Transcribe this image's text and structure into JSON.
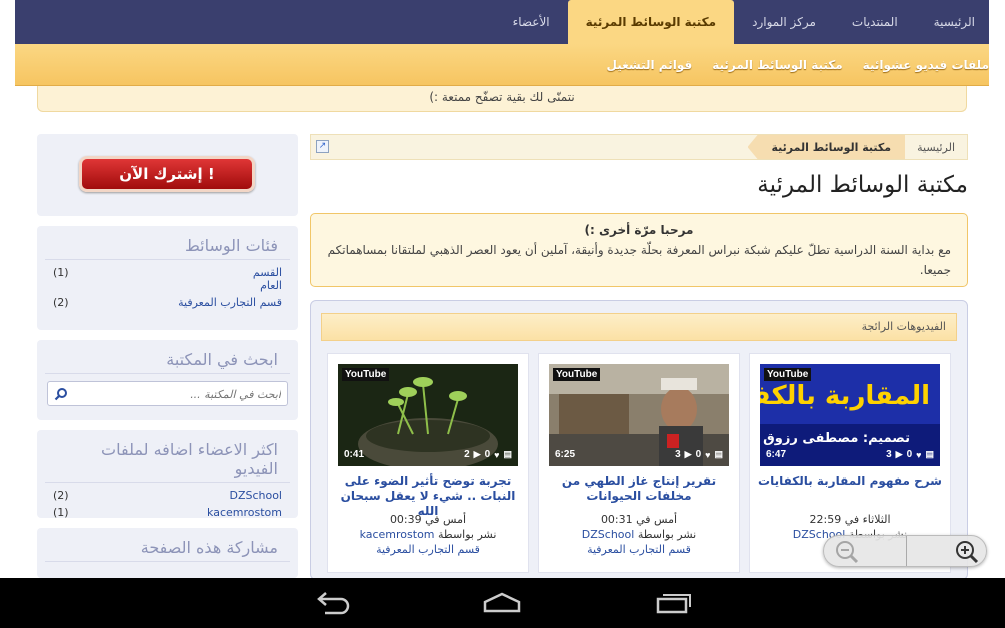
{
  "topnav": {
    "items": [
      "الرئيسية",
      "المنتديات",
      "مركز الموارد",
      "مكتبة الوسائط المرئية",
      "الأعضاء"
    ],
    "active_index": 3
  },
  "subnav": {
    "items": [
      "ملفات فيديو عشوائية",
      "مكتبة الوسائط المرئية",
      "قوائم التشغيل"
    ]
  },
  "notice": "نتمنّى لك بقية تصفّح ممتعة :)",
  "breadcrumb": {
    "home": "الرئيسية",
    "current": "مكتبة الوسائط المرئية"
  },
  "page_title": "مكتبة الوسائط المرئية",
  "welcome": {
    "title": "مرحبا مرّة أخرى :)",
    "body": "مع بداية السنة الدراسية تطلّ عليكم شبكة نبراس المعرفة بحلّة جديدة وأنيقة، آملين أن يعود العصر الذهبي لملتقانا بمساهماتكم جميعا."
  },
  "videos": {
    "heading": "الفيديوهات الرائجة",
    "items": [
      {
        "badge": "YouTube",
        "duration": "6:47",
        "views": "3",
        "likes": "0",
        "comments": "",
        "thumb_text_1": "المقاربة بالكفايات",
        "thumb_text_2": "تصميم: مصطفى رزوق",
        "title": "شرح مفهوم المقاربة بالكفايات",
        "time": "الثلاثاء في 22:59",
        "by_label": "نشر بواسطة",
        "author": "DZSchool",
        "category": ""
      },
      {
        "badge": "YouTube",
        "duration": "6:25",
        "views": "3",
        "likes": "0",
        "comments": "",
        "title": "تقرير إنتاج غاز الطهي من مخلفات الحيوانات",
        "time": "أمس في 00:31",
        "by_label": "نشر بواسطة",
        "author": "DZSchool",
        "category": "قسم التجارب المعرفية"
      },
      {
        "badge": "YouTube",
        "duration": "0:41",
        "views": "2",
        "likes": "0",
        "comments": "",
        "title": "تجربة توضح تأثير الضوء على النبات .. شيء لا يعقل سبحان الله",
        "time": "أمس في 00:39",
        "by_label": "نشر بواسطة",
        "author": "kacemrostom",
        "category": "قسم التجارب المعرفية"
      }
    ]
  },
  "sidebar": {
    "subscribe_label": "إشترك الآن !",
    "categories": {
      "title": "فئات الوسائط",
      "items": [
        {
          "label": "القسم العام",
          "count": "(1)"
        },
        {
          "label": "قسم التجارب المعرفية",
          "count": "(2)"
        }
      ]
    },
    "search": {
      "title": "ابحث في المكتبة",
      "placeholder": "ابحث في المكتبة ..."
    },
    "top_members": {
      "title": "اكثر الاعضاء اضافه لملفات الفيديو",
      "items": [
        {
          "label": "DZSchool",
          "count": "(2)"
        },
        {
          "label": "kacemrostom",
          "count": "(1)"
        }
      ]
    },
    "share": {
      "title": "مشاركة هذه الصفحة"
    }
  }
}
